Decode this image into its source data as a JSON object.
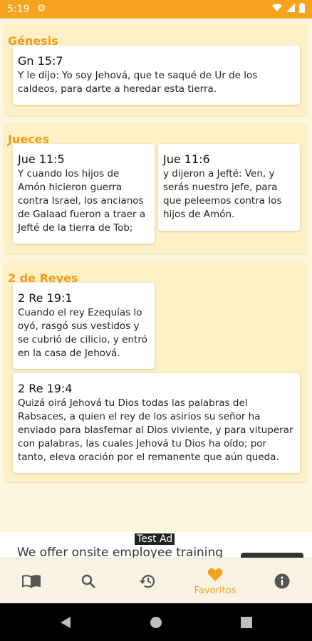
{
  "status": {
    "time": "5:19"
  },
  "sections": [
    {
      "title": "Génesis",
      "cards": [
        {
          "ref": "Gn 15:7",
          "text": "Y le dijo: Yo soy Jehová, que te saqué de Ur de los caldeos, para darte a heredar esta tierra."
        }
      ]
    },
    {
      "title": "Jueces",
      "cards": [
        {
          "ref": "Jue 11:5",
          "text": "Y cuando los hijos de Amón hicieron guerra contra Israel, los ancianos de Galaad fueron a traer a Jefté de la tierra de Tob;"
        },
        {
          "ref": "Jue 11:6",
          "text": "y dijeron a Jefté: Ven, y serás nuestro jefe, para que peleemos contra los hijos de Amón."
        }
      ]
    },
    {
      "title": "2 de Reyes",
      "cards": [
        {
          "ref": "2 Re 19:1",
          "text": "Cuando el rey Ezequías lo oyó, rasgó sus vestidos y se cubrió de cilicio, y entró en la casa de Jehová."
        },
        {
          "ref": "2 Re 19:4",
          "text": "Quizá oirá Jehová tu Dios todas las palabras del Rabsaces, a quien el rey de los asirios su señor ha enviado para blasfemar al Dios viviente, y para vituperar con palabras, las cuales Jehová tu Dios ha oído; por tanto, eleva oración por el remanente que aún queda."
        }
      ]
    }
  ],
  "ad": {
    "label": "Test Ad",
    "text": "We offer onsite employee training"
  },
  "nav": {
    "favorites_label": "Favoritos",
    "accent_color": "#f6a320"
  }
}
